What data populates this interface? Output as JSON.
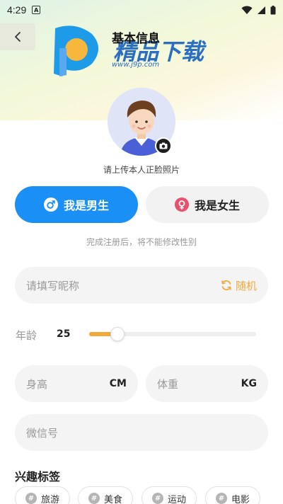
{
  "status_bar": {
    "time": "4:29",
    "notification_letter": "A"
  },
  "header": {
    "title": "基本信息",
    "watermark_brand": "精品下载",
    "watermark_url": "www.j9p.com"
  },
  "avatar": {
    "hint": "请上传本人正脸照片"
  },
  "gender": {
    "male_label": "我是男生",
    "female_label": "我是女生",
    "selected": "male",
    "note": "完成注册后，将不能修改性别"
  },
  "nickname": {
    "placeholder": "请填写昵称",
    "random_label": "随机"
  },
  "age": {
    "label": "年龄",
    "value": "25",
    "slider_fraction": 0.17
  },
  "height": {
    "placeholder": "身高",
    "unit": "CM"
  },
  "weight": {
    "placeholder": "体重",
    "unit": "KG"
  },
  "wechat": {
    "placeholder": "微信号"
  },
  "interests": {
    "title": "兴趣标签",
    "tags": [
      "旅游",
      "美食",
      "运动",
      "电影"
    ]
  },
  "colors": {
    "primary_blue": "#1a8ff5",
    "accent_orange": "#f2a93b",
    "female_pink": "#e8506e"
  }
}
